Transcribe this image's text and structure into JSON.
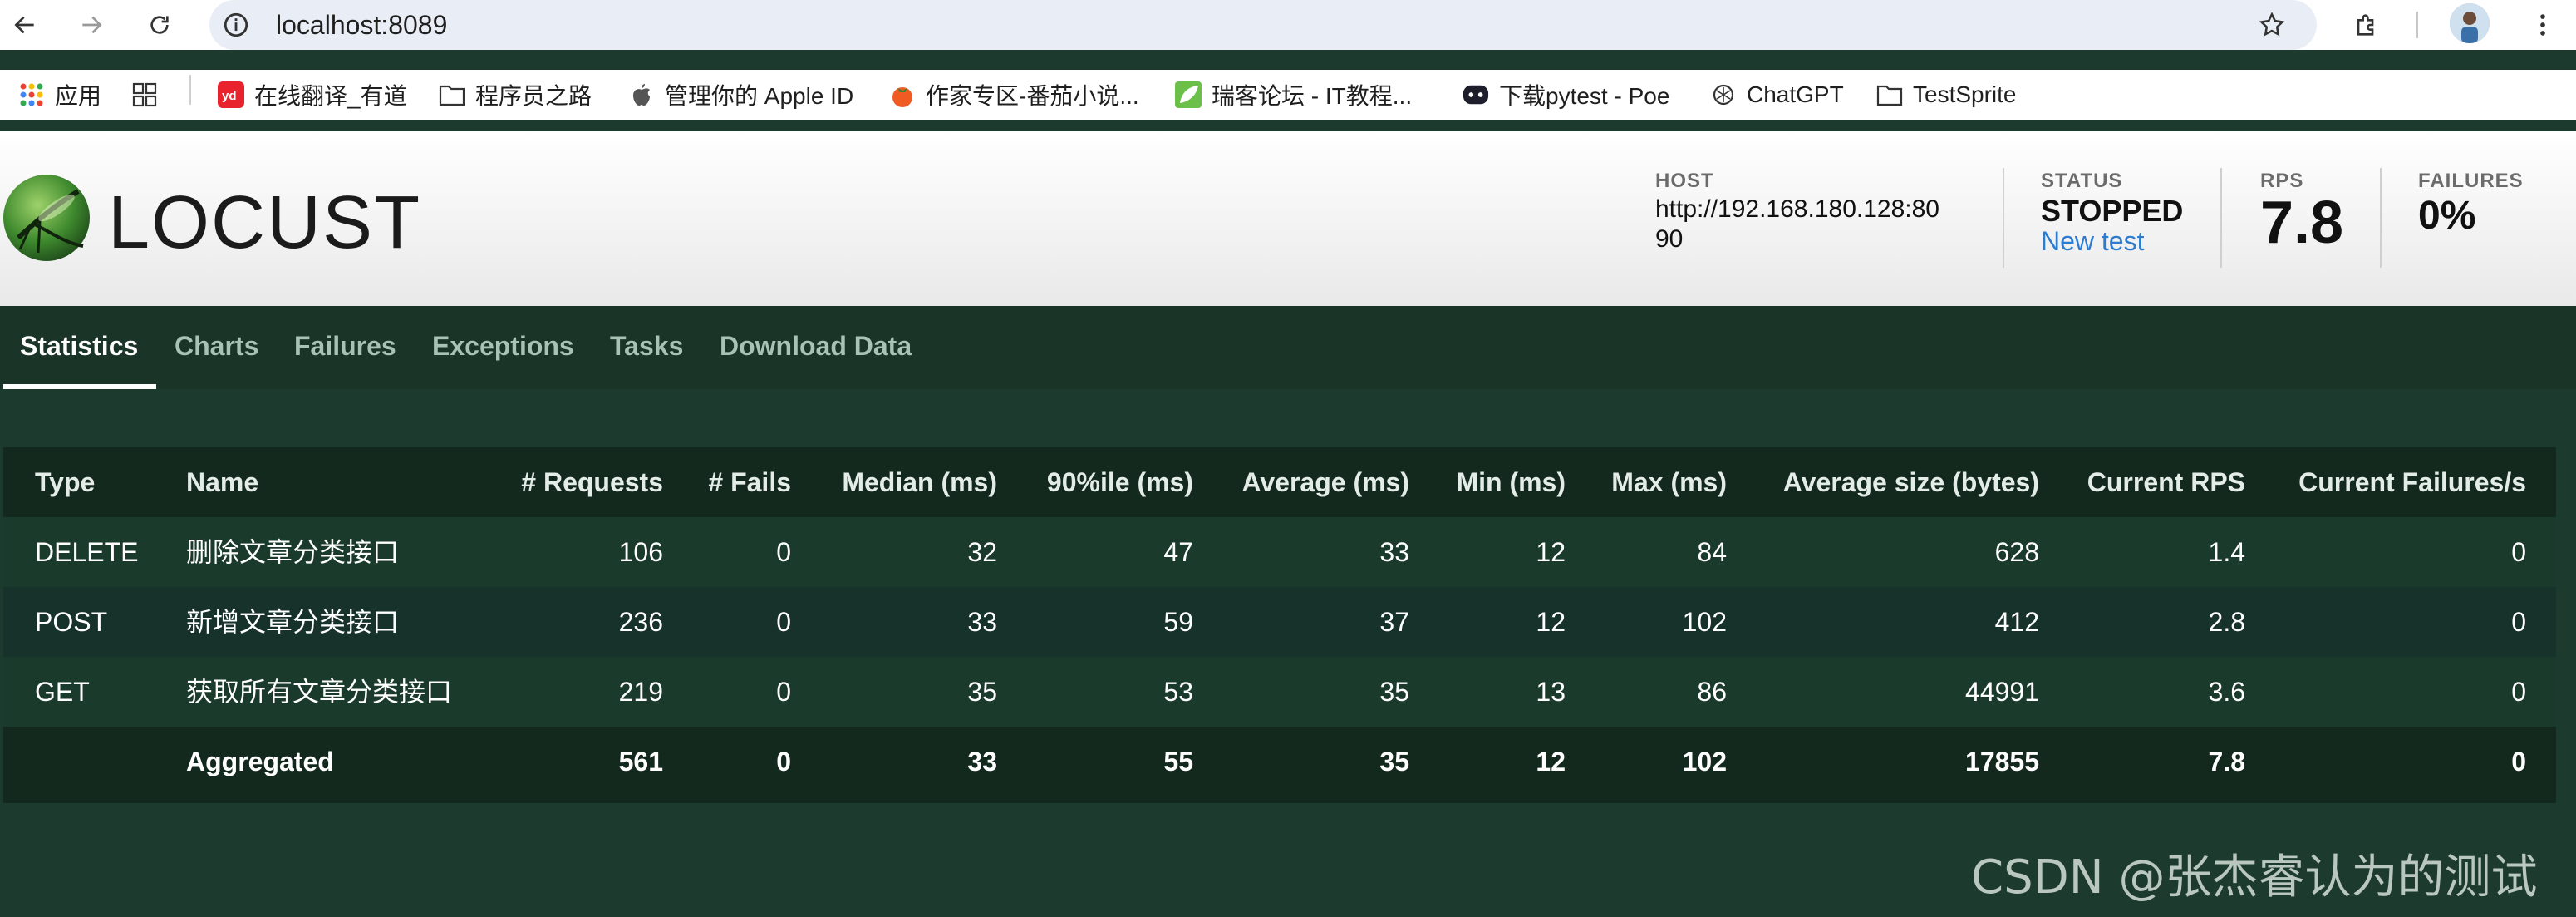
{
  "browser": {
    "url": "localhost:8089",
    "bookmarks": [
      {
        "label": "应用",
        "icon": "apps-grid-icon"
      },
      {
        "label": "",
        "icon": "tab-groups-icon"
      },
      {
        "label": "在线翻译_有道",
        "icon": "youdao-icon"
      },
      {
        "label": "程序员之路",
        "icon": "folder-icon"
      },
      {
        "label": "管理你的 Apple ID",
        "icon": "apple-icon"
      },
      {
        "label": "作家专区-番茄小说...",
        "icon": "tomato-icon"
      },
      {
        "label": "瑞客论坛 - IT教程...",
        "icon": "leaf-icon"
      },
      {
        "label": "下载pytest - Poe",
        "icon": "poe-icon"
      },
      {
        "label": "ChatGPT",
        "icon": "chatgpt-icon"
      },
      {
        "label": "TestSprite",
        "icon": "folder-icon"
      }
    ]
  },
  "header": {
    "logo_text": "LOCUST",
    "host_label": "HOST",
    "host_value_line1": "http://192.168.180.128:80",
    "host_value_line2": "90",
    "status_label": "STATUS",
    "status_value": "STOPPED",
    "new_test_label": "New test",
    "rps_label": "RPS",
    "rps_value": "7.8",
    "failures_label": "FAILURES",
    "failures_value": "0%"
  },
  "tabs": [
    "Statistics",
    "Charts",
    "Failures",
    "Exceptions",
    "Tasks",
    "Download Data"
  ],
  "table": {
    "columns": [
      "Type",
      "Name",
      "# Requests",
      "# Fails",
      "Median (ms)",
      "90%ile (ms)",
      "Average (ms)",
      "Min (ms)",
      "Max (ms)",
      "Average size (bytes)",
      "Current RPS",
      "Current Failures/s"
    ],
    "rows": [
      [
        "DELETE",
        "删除文章分类接口",
        "106",
        "0",
        "32",
        "47",
        "33",
        "12",
        "84",
        "628",
        "1.4",
        "0"
      ],
      [
        "POST",
        "新增文章分类接口",
        "236",
        "0",
        "33",
        "59",
        "37",
        "12",
        "102",
        "412",
        "2.8",
        "0"
      ],
      [
        "GET",
        "获取所有文章分类接口",
        "219",
        "0",
        "35",
        "53",
        "35",
        "13",
        "86",
        "44991",
        "3.6",
        "0"
      ]
    ],
    "aggregated": [
      "",
      "Aggregated",
      "561",
      "0",
      "33",
      "55",
      "35",
      "12",
      "102",
      "17855",
      "7.8",
      "0"
    ]
  },
  "watermark": "CSDN @张杰睿认为的测试",
  "colors": {
    "page_bg": "#1c3b2e",
    "table_bg": "#13291e",
    "row_alt": "#1a3a2c",
    "accent_link": "#2b7bd1"
  }
}
